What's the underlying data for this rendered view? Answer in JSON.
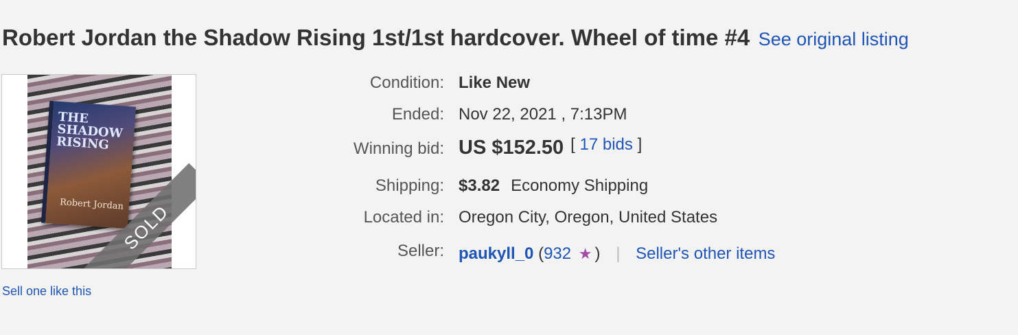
{
  "listing": {
    "title": "Robert Jordan the Shadow Rising 1st/1st hardcover. Wheel of time #4",
    "original_link": "See original listing"
  },
  "image": {
    "badge": "SOLD",
    "cover_title": "THE SHADOW RISING",
    "cover_author": "Robert Jordan"
  },
  "sell_link": "Sell one like this",
  "details": {
    "condition": {
      "label": "Condition:",
      "value": "Like New"
    },
    "ended": {
      "label": "Ended:",
      "value": "Nov 22, 2021 , 7:13PM"
    },
    "winning_bid": {
      "label": "Winning bid:",
      "value": "US $152.50",
      "bracket_open": "[",
      "bids_link": "17 bids",
      "bracket_close": "]"
    },
    "shipping": {
      "label": "Shipping:",
      "price": "$3.82",
      "method": "Economy Shipping"
    },
    "located": {
      "label": "Located in:",
      "value": "Oregon City, Oregon, United States"
    },
    "seller": {
      "label": "Seller:",
      "name": "paukyll_0",
      "paren_open": "(",
      "feedback": "932",
      "star_icon": "purple-star-icon",
      "paren_close": ")",
      "separator": "|",
      "other_items": "Seller's other items"
    }
  },
  "colors": {
    "link": "#1f55b5",
    "background": "#f3f3f3",
    "star": "#a24ca8"
  }
}
